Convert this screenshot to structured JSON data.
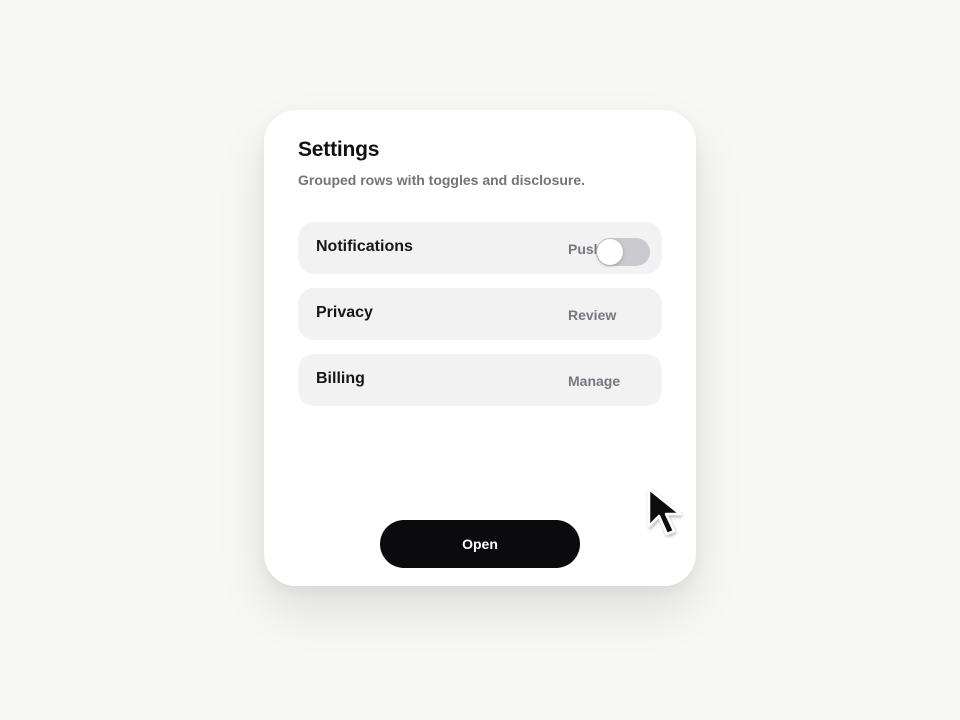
{
  "card": {
    "title": "Settings",
    "subtitle": "Grouped rows with toggles and disclosure."
  },
  "rows": [
    {
      "label": "Notifications",
      "value": "Push",
      "toggle_on": false
    },
    {
      "label": "Privacy",
      "value": "Review"
    },
    {
      "label": "Billing",
      "value": "Manage"
    }
  ],
  "button": {
    "label": "Open"
  },
  "icons": {
    "cursor": "mouse-pointer-icon"
  },
  "colors": {
    "background": "#f7f7f5",
    "card": "#ffffff",
    "row": "#f2f2f3",
    "toggle_off": "#c9c9ce",
    "button": "#0b0b0e"
  }
}
